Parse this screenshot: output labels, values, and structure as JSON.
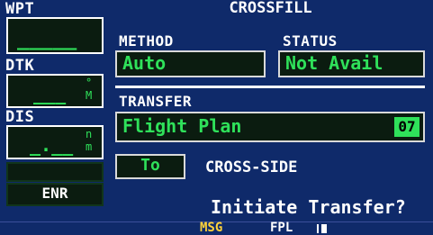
{
  "sidebar": {
    "wpt_label": "WPT",
    "wpt_value": "_____",
    "dtk_label": "DTK",
    "dtk_value": "___",
    "dtk_unit_top": "°",
    "dtk_unit_bottom": "M",
    "dis_label": "DIS",
    "dis_value": "_.__",
    "dis_unit_top": "n",
    "dis_unit_bottom": "m",
    "enr_label": "ENR"
  },
  "panel": {
    "title": "CROSSFILL",
    "method_label": "METHOD",
    "method_value": "Auto",
    "status_label": "STATUS",
    "status_value": "Not Avail",
    "transfer_label": "TRANSFER",
    "transfer_value": "Flight Plan",
    "transfer_number": "07",
    "to_button": "To",
    "cross_side": "CROSS-SIDE",
    "initiate": "Initiate Transfer?"
  },
  "statusbar": {
    "msg": "MSG",
    "fpl": "FPL"
  },
  "colors": {
    "panel_bg": "#0f2a6a",
    "field_text": "#2fe15a",
    "msg": "#ffd23a"
  }
}
